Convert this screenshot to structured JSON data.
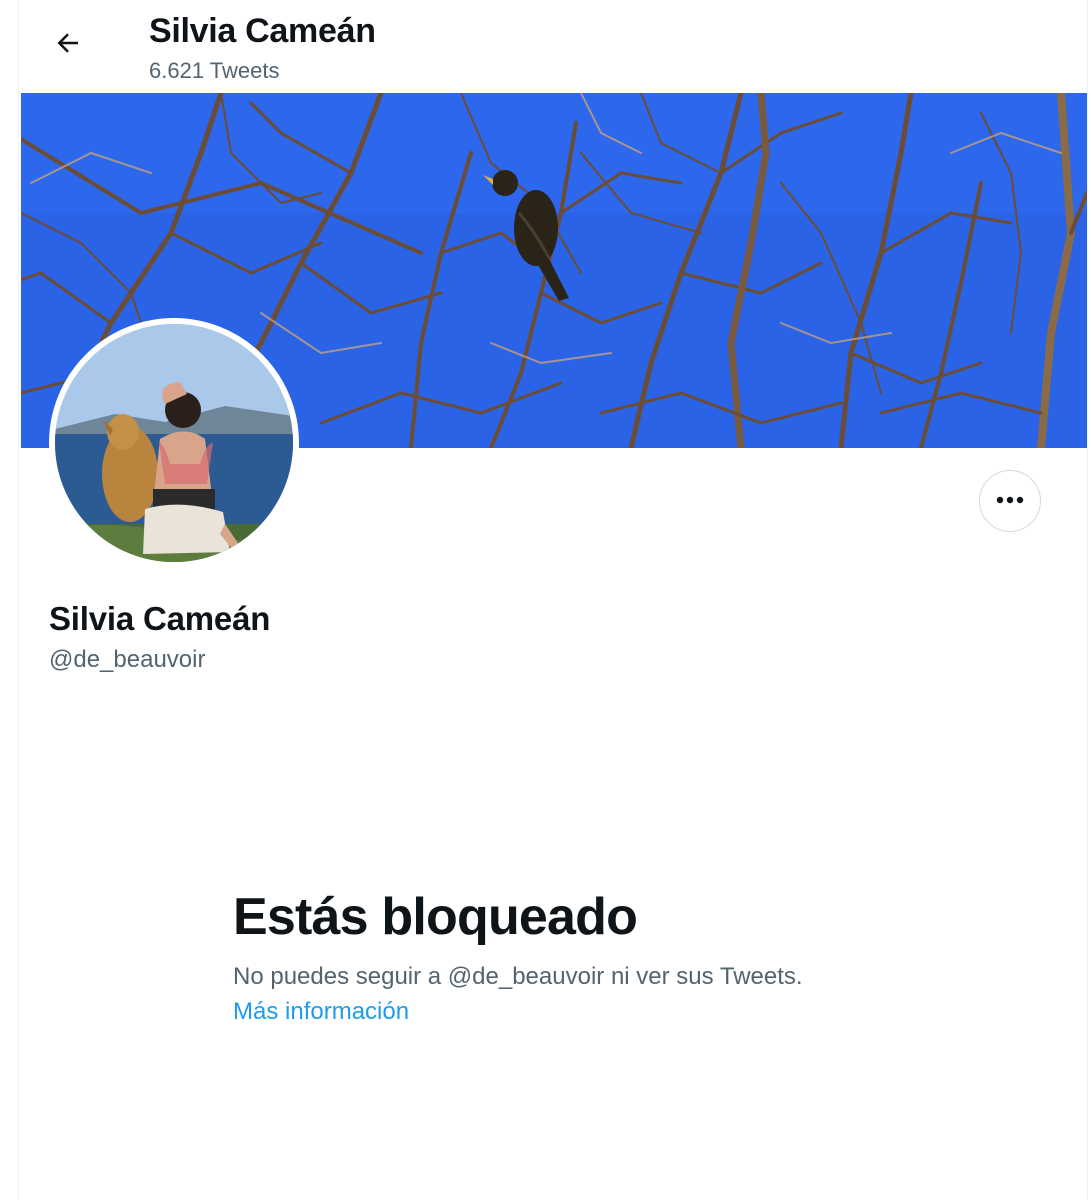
{
  "header": {
    "name": "Silvia Cameán",
    "tweet_count": "6.621 Tweets"
  },
  "profile": {
    "display_name": "Silvia Cameán",
    "handle": "@de_beauvoir"
  },
  "blocked_notice": {
    "title": "Estás bloqueado",
    "message": "No puedes seguir a @de_beauvoir ni ver sus Tweets.",
    "link_label": "Más información"
  },
  "icons": {
    "back": "arrow-left-icon",
    "more": "more-horizontal-icon"
  },
  "colors": {
    "link": "#1d9bf0",
    "secondary_text": "#536471",
    "banner_sky": "#2a63e6"
  }
}
